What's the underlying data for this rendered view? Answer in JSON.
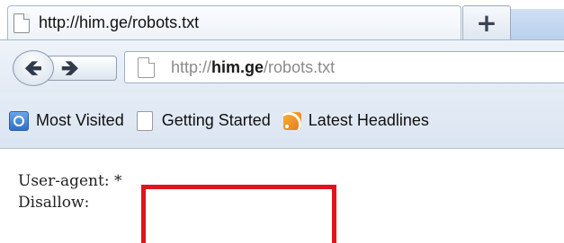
{
  "browser": {
    "tab": {
      "title": "http://him.ge/robots.txt",
      "icon": "page-icon"
    },
    "new_tab_label": "+",
    "nav": {
      "back_icon": "back-arrow-icon",
      "forward_icon": "forward-arrow-icon",
      "back_glyph": "🡸",
      "forward_glyph": "🡺"
    },
    "address_bar": {
      "prefix": "http://",
      "domain": "him.ge",
      "path": "/robots.txt"
    },
    "bookmarks": [
      {
        "label": "Most Visited",
        "icon": "most-visited-icon"
      },
      {
        "label": "Getting Started",
        "icon": "page-icon"
      },
      {
        "label": "Latest Headlines",
        "icon": "rss-icon"
      }
    ]
  },
  "page": {
    "lines": [
      "User-agent: *",
      "Disallow: "
    ]
  },
  "colors": {
    "redaction_border": "#e0141a",
    "chrome_bg": "#e2eaf4"
  }
}
